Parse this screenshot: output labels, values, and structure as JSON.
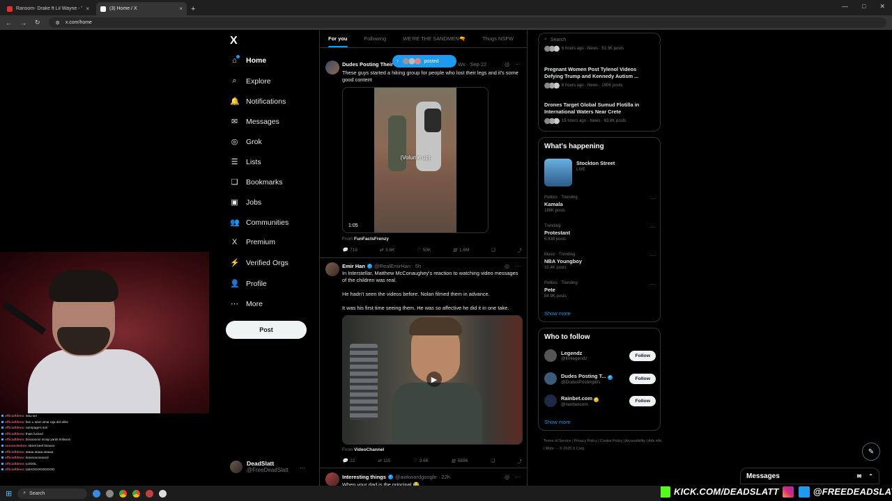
{
  "browser": {
    "tabs": [
      {
        "title": "Ransom- Drake ft Lil Wayne - Y",
        "close": "×",
        "color": "#e5302f"
      },
      {
        "title": "(3) Home / X",
        "close": "×",
        "color": "#ffffff"
      }
    ],
    "new_tab": "+",
    "url": "x.com/home",
    "window_controls": [
      "—",
      "□",
      "✕"
    ]
  },
  "leftnav": {
    "logo": "X",
    "items": [
      {
        "label": "Home",
        "icon": "⌂"
      },
      {
        "label": "Explore",
        "icon": "⌕"
      },
      {
        "label": "Notifications",
        "icon": "🔔"
      },
      {
        "label": "Messages",
        "icon": "✉"
      },
      {
        "label": "Grok",
        "icon": "◎"
      },
      {
        "label": "Lists",
        "icon": "☰"
      },
      {
        "label": "Bookmarks",
        "icon": "❑"
      },
      {
        "label": "Jobs",
        "icon": "▣"
      },
      {
        "label": "Communities",
        "icon": "👥"
      },
      {
        "label": "Premium",
        "icon": "X"
      },
      {
        "label": "Verified Orgs",
        "icon": "⚡"
      },
      {
        "label": "Profile",
        "icon": "👤"
      },
      {
        "label": "More",
        "icon": "⋯"
      }
    ],
    "post_button": "Post",
    "account": {
      "name": "DeadSlatt",
      "handle": "@FreeDeadSlatt",
      "more": "···"
    }
  },
  "chat": [
    {
      "user": "officialfdeno",
      "msg": ": ниш юн"
    },
    {
      "user": "officialfdeno",
      "msg": ": fam u seen what raja did ahlie"
    },
    {
      "user": "officialfdeno",
      "msg": ": ramrpage's son"
    },
    {
      "user": "officialfdeno",
      "msg": ": thats fucked"
    },
    {
      "user": "officialfdeno",
      "msg": ": booooooo! scrap yards lmfaooo"
    },
    {
      "user": "unrevealedme",
      "msg": ": street beef lmaooo"
    },
    {
      "user": "officialfdeno",
      "msg": ": ataaa ataaa ataaaa"
    },
    {
      "user": "officialfdeno",
      "msg": ": looooooooooool"
    },
    {
      "user": "officialfdeno",
      "msg": ": LOOOL"
    },
    {
      "user": "officialfdeno",
      "msg": ": LMAOOOOOOOOO"
    }
  ],
  "timeline": {
    "tabs": [
      "For you",
      "Following",
      "WE'RE THE SANDMEN🔫",
      "Thugs NSFW"
    ],
    "new_posts_pill": "posted",
    "posts": [
      {
        "name": "Dudes Posting Their",
        "meta": "Ws · Sep 22",
        "text": "These guys started a hiking group for people who lost their legs and it's some good content",
        "video_caption": "(Volume up)",
        "duration": "1:05",
        "from_prefix": "From ",
        "from": "FunFactsFrenzy",
        "replies": "718",
        "reposts": "3.6K",
        "likes": "50K",
        "views": "1.6M"
      },
      {
        "name": "Emir Han",
        "handle": "@RealEmirHan · 5h",
        "text1": "In Interstellar, Matthew McConaughey's reaction to watching video messages of the children was real.",
        "text2": "He hadn't seen the videos before. Nolan filmed them in advance.",
        "text3": "It was his first time seeing them. He was so affective he did it in one take.",
        "from_prefix": "From ",
        "from": "VideoChannel",
        "replies": "22",
        "reposts": "115",
        "likes": "3.6K",
        "views": "589K"
      },
      {
        "name": "Interesting things",
        "handle": "@awkwardgoogle · 22h",
        "text": "When your dad is the principal 😂"
      }
    ]
  },
  "right": {
    "search_placeholder": "Search",
    "news": [
      {
        "headline": "",
        "meta": "6 hours ago · News · 51.3K posts"
      },
      {
        "headline": "Pregnant Women Post Tylenol Videos Defying Trump and Kennedy Autism ...",
        "meta": "6 hours ago · News · 190K posts"
      },
      {
        "headline": "Drones Target Global Sumud Flotilla in International Waters Near Crete",
        "meta": "15 hours ago · News · 63.8K posts"
      }
    ],
    "whats_happening": {
      "title": "What's happening",
      "live": {
        "name": "Stockton Street",
        "status": "LIVE"
      },
      "trends": [
        {
          "cat": "Politics · Trending",
          "name": "Kamala",
          "count": "188K posts"
        },
        {
          "cat": "Trending",
          "name": "Protestant",
          "count": "6,938 posts"
        },
        {
          "cat": "Music · Trending",
          "name": "NBA Youngboy",
          "count": "32.4K posts"
        },
        {
          "cat": "Politics · Trending",
          "name": "Pete",
          "count": "84.9K posts"
        }
      ],
      "show_more": "Show more"
    },
    "who_to_follow": {
      "title": "Who to follow",
      "accounts": [
        {
          "name": "Legendz",
          "handle": "@llmlegendz",
          "color": "#555555"
        },
        {
          "name": "Dudes Posting T...",
          "handle": "@DudesPostingWs",
          "color": "#3a5a7a"
        },
        {
          "name": "Rainbet.com",
          "handle": "@rainbetcom",
          "color": "#1e2a44"
        }
      ],
      "follow_label": "Follow",
      "show_more": "Show more"
    },
    "footer": "Terms of Service | Privacy Policy | Cookie Policy | Accessibility | Ads info | More ··· © 2025 X Corp."
  },
  "messages_bar": {
    "title": "Messages"
  },
  "socials": {
    "kick": "KICK.COM/DEADSLATT",
    "handle": "@FREEDEADSLATT"
  },
  "taskbar": {
    "search": "Search"
  }
}
